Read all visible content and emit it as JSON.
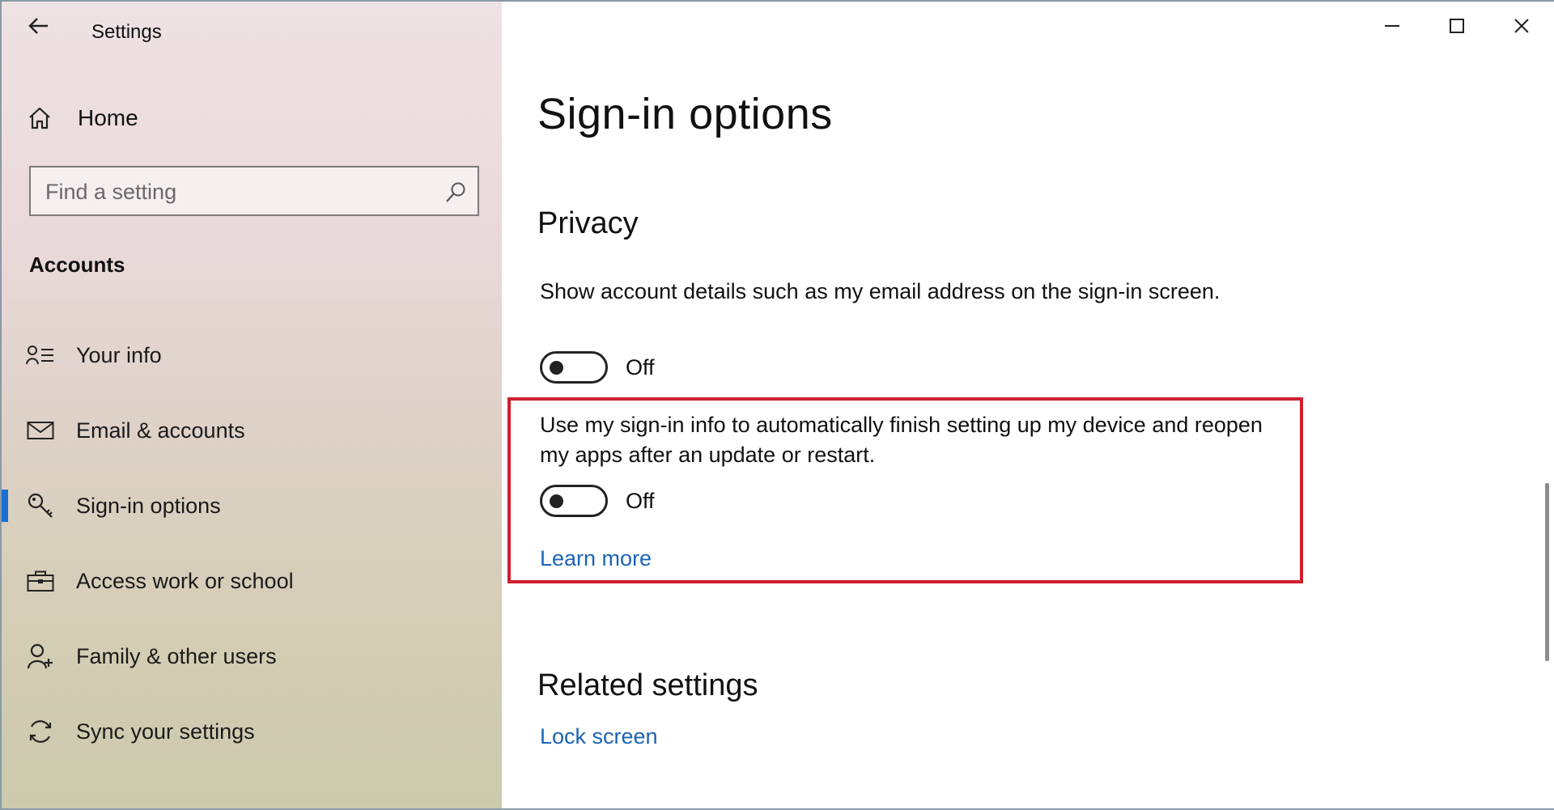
{
  "window": {
    "title": "Settings",
    "controls": {
      "minimize_icon": "minimize-icon",
      "maximize_icon": "maximize-icon",
      "close_icon": "close-icon"
    }
  },
  "sidebar": {
    "home_label": "Home",
    "search_placeholder": "Find a setting",
    "section_title": "Accounts",
    "items": [
      {
        "label": "Your info",
        "icon": "person-card-icon",
        "active": false
      },
      {
        "label": "Email & accounts",
        "icon": "mail-icon",
        "active": false
      },
      {
        "label": "Sign-in options",
        "icon": "key-icon",
        "active": true
      },
      {
        "label": "Access work or school",
        "icon": "briefcase-icon",
        "active": false
      },
      {
        "label": "Family & other users",
        "icon": "person-add-icon",
        "active": false
      },
      {
        "label": "Sync your settings",
        "icon": "sync-icon",
        "active": false
      }
    ]
  },
  "main": {
    "page_title": "Sign-in options",
    "privacy": {
      "heading": "Privacy",
      "setting1": {
        "description": "Show account details such as my email address on the sign-in screen.",
        "state_label": "Off",
        "on": false
      },
      "setting2": {
        "description": "Use my sign-in info to automatically finish setting up my device and reopen my apps after an update or restart.",
        "state_label": "Off",
        "on": false,
        "learn_more": "Learn more"
      }
    },
    "related": {
      "heading": "Related settings",
      "link": "Lock screen"
    }
  },
  "colors": {
    "accent": "#1a6fd1",
    "link": "#1a64b5",
    "highlight_border": "#cf1f2e"
  }
}
